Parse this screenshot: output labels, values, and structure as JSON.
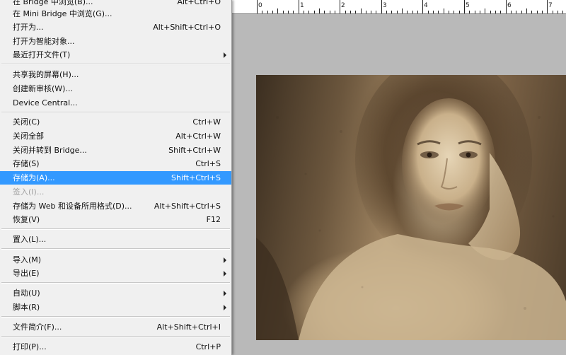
{
  "menu": {
    "items": [
      {
        "label": "在 Bridge 中浏览(B)...",
        "shortcut": "Alt+Ctrl+O"
      },
      {
        "label": "在 Mini Bridge 中浏览(G)...",
        "shortcut": ""
      },
      {
        "label": "打开为...",
        "shortcut": "Alt+Shift+Ctrl+O"
      },
      {
        "label": "打开为智能对象...",
        "shortcut": ""
      },
      {
        "label": "最近打开文件(T)",
        "shortcut": ""
      },
      {
        "label": "共享我的屏幕(H)...",
        "shortcut": ""
      },
      {
        "label": "创建新审核(W)...",
        "shortcut": ""
      },
      {
        "label": "Device Central...",
        "shortcut": ""
      },
      {
        "label": "关闭(C)",
        "shortcut": "Ctrl+W"
      },
      {
        "label": "关闭全部",
        "shortcut": "Alt+Ctrl+W"
      },
      {
        "label": "关闭并转到 Bridge...",
        "shortcut": "Shift+Ctrl+W"
      },
      {
        "label": "存储(S)",
        "shortcut": "Ctrl+S"
      },
      {
        "label": "存储为(A)...",
        "shortcut": "Shift+Ctrl+S"
      },
      {
        "label": "签入(I)...",
        "shortcut": ""
      },
      {
        "label": "存储为 Web 和设备所用格式(D)...",
        "shortcut": "Alt+Shift+Ctrl+S"
      },
      {
        "label": "恢复(V)",
        "shortcut": "F12"
      },
      {
        "label": "置入(L)...",
        "shortcut": ""
      },
      {
        "label": "导入(M)",
        "shortcut": ""
      },
      {
        "label": "导出(E)",
        "shortcut": ""
      },
      {
        "label": "自动(U)",
        "shortcut": ""
      },
      {
        "label": "脚本(R)",
        "shortcut": ""
      },
      {
        "label": "文件简介(F)...",
        "shortcut": "Alt+Shift+Ctrl+I"
      },
      {
        "label": "打印(P)...",
        "shortcut": "Ctrl+P"
      }
    ]
  },
  "ruler": {
    "labels": [
      "0",
      "1",
      "2",
      "3",
      "4",
      "5",
      "6",
      "7"
    ]
  },
  "colors": {
    "highlight": "#3399ff",
    "menu_bg": "#f0f0f0",
    "workspace_bg": "#b9b9b9"
  }
}
